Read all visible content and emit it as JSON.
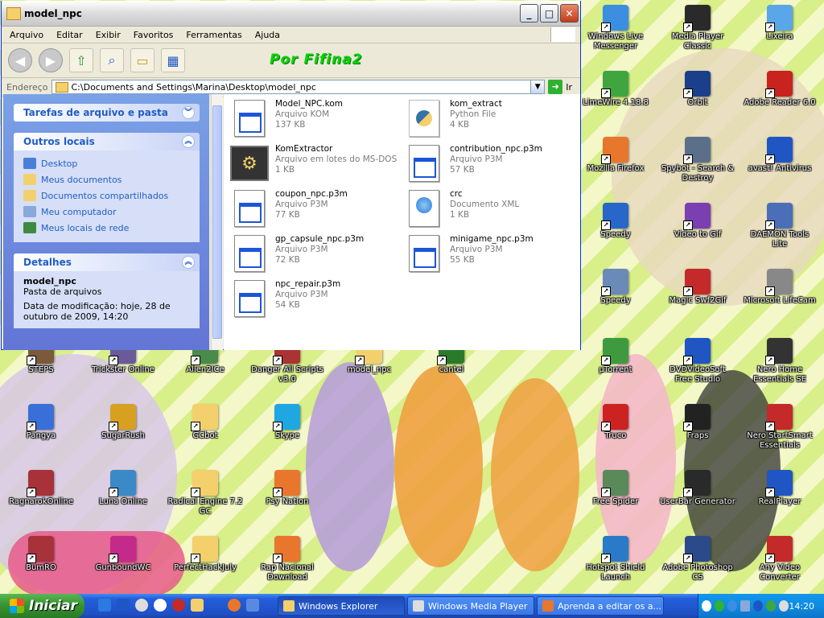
{
  "window": {
    "title": "model_npc",
    "menu": [
      "Arquivo",
      "Editar",
      "Exibir",
      "Favoritos",
      "Ferramentas",
      "Ajuda"
    ],
    "watermark": "Por Fifina2",
    "address_label": "Endereço",
    "address_value": "C:\\Documents and Settings\\Marina\\Desktop\\model_npc",
    "go_label": "Ir"
  },
  "tasks_panel": {
    "title": "Tarefas de arquivo e pasta"
  },
  "places_panel": {
    "title": "Outros locais",
    "links": [
      {
        "label": "Desktop",
        "color": "#4a7fd8"
      },
      {
        "label": "Meus documentos",
        "color": "#f3d06b"
      },
      {
        "label": "Documentos compartilhados",
        "color": "#f3d06b"
      },
      {
        "label": "Meu computador",
        "color": "#8aa8d8"
      },
      {
        "label": "Meus locais de rede",
        "color": "#3f8a3f"
      }
    ]
  },
  "details_panel": {
    "title": "Detalhes",
    "name": "model_npc",
    "type": "Pasta de arquivos",
    "modified": "Data de modificação: hoje, 28 de outubro de 2009, 14:20"
  },
  "files": [
    {
      "name": "Model_NPC.kom",
      "type": "Arquivo KOM",
      "size": "137 KB",
      "icon": "doc-icon"
    },
    {
      "name": "kom_extract",
      "type": "Python File",
      "size": "4 KB",
      "icon": "python-file-icon"
    },
    {
      "name": "KomExtractor",
      "type": "Arquivo em lotes do MS-DOS",
      "size": "1 KB",
      "icon": "batch-gear-icon"
    },
    {
      "name": "contribution_npc.p3m",
      "type": "Arquivo P3M",
      "size": "57 KB",
      "icon": "doc-icon"
    },
    {
      "name": "coupon_npc.p3m",
      "type": "Arquivo P3M",
      "size": "77 KB",
      "icon": "doc-icon"
    },
    {
      "name": "crc",
      "type": "Documento XML",
      "size": "1 KB",
      "icon": "xml-doc-icon"
    },
    {
      "name": "gp_capsule_npc.p3m",
      "type": "Arquivo P3M",
      "size": "72 KB",
      "icon": "doc-icon"
    },
    {
      "name": "minigame_npc.p3m",
      "type": "Arquivo P3M",
      "size": "55 KB",
      "icon": "doc-icon"
    },
    {
      "name": "npc_repair.p3m",
      "type": "Arquivo P3M",
      "size": "54 KB",
      "icon": "doc-icon"
    }
  ],
  "desktop_icons": [
    {
      "label": "Windows Live Messenger",
      "color": "#3b8ee0"
    },
    {
      "label": "Media Player Classic",
      "color": "#2a2a2a"
    },
    {
      "label": "Lixeira",
      "color": "#59a7e8"
    },
    {
      "label": "LimeWire 4.18.8",
      "color": "#3fa63f"
    },
    {
      "label": "Orbit",
      "color": "#1c3f8a"
    },
    {
      "label": "Adobe Reader 6.0",
      "color": "#c8231f"
    },
    {
      "label": "Mozilla Firefox",
      "color": "#e8762c"
    },
    {
      "label": "Spybot - Search & Destroy",
      "color": "#5c6f8a"
    },
    {
      "label": "avast! Antivirus",
      "color": "#1f56c4"
    },
    {
      "label": "Speedy",
      "color": "#2767c9"
    },
    {
      "label": "Video to Gif",
      "color": "#7a3fb0"
    },
    {
      "label": "DAEMON Tools Lite",
      "color": "#4a6fb8"
    },
    {
      "label": "Speedy",
      "color": "#6a8ab8"
    },
    {
      "label": "Magic Swf2Gif",
      "color": "#c42a2a"
    },
    {
      "label": "Microsoft LifeCam",
      "color": "#888888"
    },
    {
      "label": "STEPS",
      "color": "#7a5a3a"
    },
    {
      "label": "Trickster Online",
      "color": "#6a5a9a"
    },
    {
      "label": "Alien2ICe",
      "color": "#4a8a4a"
    },
    {
      "label": "Danger All Scripts v3.0",
      "color": "#aa3333"
    },
    {
      "label": "model_npc",
      "color": "#f3d06b"
    },
    {
      "label": "cantel",
      "color": "#2a7a2a"
    },
    {
      "label": "µTorrent",
      "color": "#3f9a3f"
    },
    {
      "label": "DVDVideoSoft Free Studio",
      "color": "#1f56c4"
    },
    {
      "label": "Nero Home Essentials SE",
      "color": "#333333"
    },
    {
      "label": "Pangya",
      "color": "#3b6fd8"
    },
    {
      "label": "SugarRush",
      "color": "#d8a020"
    },
    {
      "label": "GCbot",
      "color": "#f3d06b"
    },
    {
      "label": "Skype",
      "color": "#1ea7e1"
    },
    {
      "label": "Truco",
      "color": "#cc2222"
    },
    {
      "label": "Fraps",
      "color": "#222222"
    },
    {
      "label": "Nero StartSmart Essentials",
      "color": "#c42a2a"
    },
    {
      "label": "RagnarokOnline",
      "color": "#a8323a"
    },
    {
      "label": "Luna Online",
      "color": "#3a8ac8"
    },
    {
      "label": "Radical Engine 7.2 GC",
      "color": "#f3d06b"
    },
    {
      "label": "Psy Nation",
      "color": "#e8762c"
    },
    {
      "label": "Free Spider",
      "color": "#5a8a5a"
    },
    {
      "label": "UserBar Generator",
      "color": "#2a2a2a"
    },
    {
      "label": "RealPlayer",
      "color": "#1f56c4"
    },
    {
      "label": "BumRO",
      "color": "#a8323a"
    },
    {
      "label": "GunboundWC",
      "color": "#c42a8a"
    },
    {
      "label": "PerfectHackJuly",
      "color": "#f3d06b"
    },
    {
      "label": "Rap Nacional Download",
      "color": "#e8762c"
    },
    {
      "label": "Hotspot Shield Launch",
      "color": "#2a7ac8"
    },
    {
      "label": "Adobe Photoshop CS",
      "color": "#2a4a8a"
    },
    {
      "label": "Any Video Converter",
      "color": "#c42a2a"
    }
  ],
  "taskbar": {
    "start_label": "Iniciar",
    "buttons": [
      {
        "label": "Windows Explorer",
        "active": true
      },
      {
        "label": "Windows Media Player",
        "active": false
      },
      {
        "label": "Aprenda a editar os a...",
        "active": false
      }
    ],
    "clock": "14:20"
  }
}
